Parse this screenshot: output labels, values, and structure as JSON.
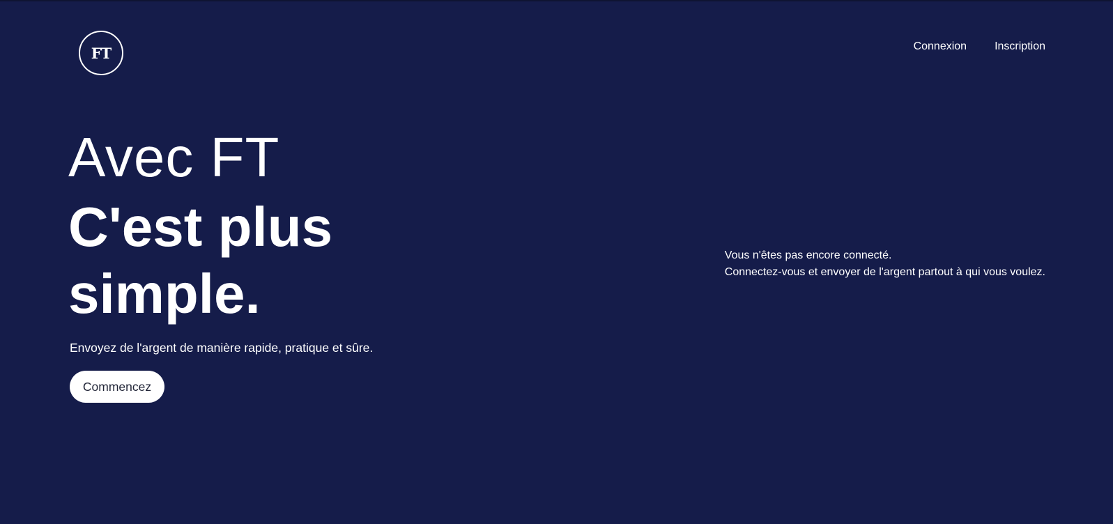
{
  "logo": {
    "text": "FT"
  },
  "nav": {
    "login": "Connexion",
    "signup": "Inscription"
  },
  "hero": {
    "line1": "Avec FT",
    "line2": "C'est plus simple.",
    "subtitle": "Envoyez de l'argent de manière rapide, pratique et sûre.",
    "cta": "Commencez"
  },
  "notice": {
    "line1": "Vous n'êtes pas encore connecté.",
    "line2": "Connectez-vous et envoyer de l'argent partout à qui vous voulez."
  },
  "colors": {
    "background": "#151c4a",
    "text": "#ffffff",
    "button_bg": "#ffffff",
    "button_text": "#222638"
  }
}
